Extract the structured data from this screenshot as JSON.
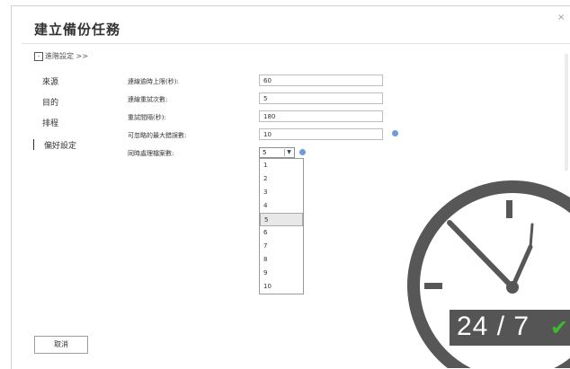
{
  "dialog": {
    "title": "建立備份任務",
    "close_glyph": "×",
    "advanced_toggle": {
      "box": "-",
      "label": "進階設定 >>"
    },
    "cancel_label": "取消"
  },
  "sidebar": {
    "items": [
      {
        "label": "來源",
        "active": false
      },
      {
        "label": "目的",
        "active": false
      },
      {
        "label": "排程",
        "active": false
      },
      {
        "label": "偏好設定",
        "active": true
      }
    ]
  },
  "fields": [
    {
      "label": "連線逾時上限(秒):",
      "value": "60"
    },
    {
      "label": "連線重試次數:",
      "value": "5"
    },
    {
      "label": "重試間隔(秒):",
      "value": "180"
    },
    {
      "label": "可忽略的最大錯誤數:",
      "value": "10"
    },
    {
      "label": "同時處理檔案數:",
      "value": "5"
    }
  ],
  "select": {
    "value": "5",
    "arrow": "▼",
    "options": [
      "1",
      "2",
      "3",
      "4",
      "5",
      "6",
      "7",
      "8",
      "9",
      "10"
    ],
    "highlighted": "5"
  },
  "badge": {
    "text": "24 / 7",
    "check": "✔"
  },
  "colors": {
    "help_icon": "#6f9bd8",
    "badge_bg": "#555555",
    "check": "#3cba2f",
    "clock": "#575757"
  }
}
